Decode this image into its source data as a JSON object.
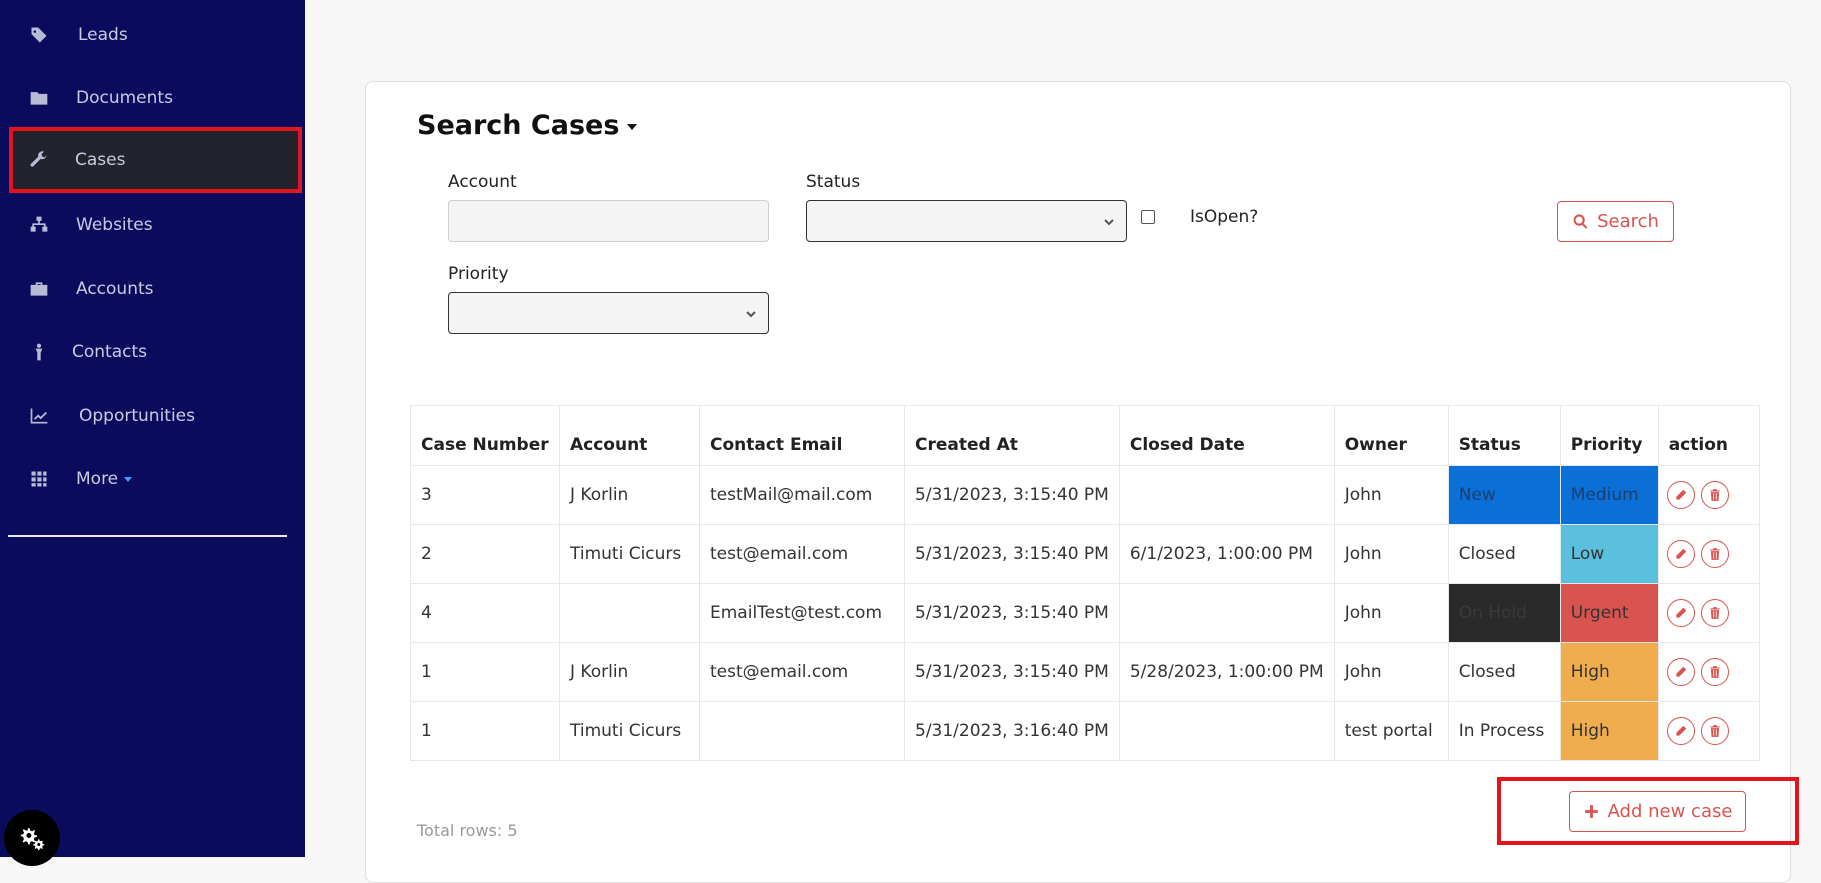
{
  "sidebar": {
    "items": [
      {
        "label": "Leads",
        "icon": "tags-icon"
      },
      {
        "label": "Documents",
        "icon": "folder-icon"
      },
      {
        "label": "Cases",
        "icon": "wrench-icon"
      },
      {
        "label": "Websites",
        "icon": "sitemap-icon"
      },
      {
        "label": "Accounts",
        "icon": "briefcase-icon"
      },
      {
        "label": "Contacts",
        "icon": "person-icon"
      },
      {
        "label": "Opportunities",
        "icon": "line-chart-icon"
      },
      {
        "label": "More",
        "icon": "grid-icon"
      }
    ],
    "active": "Cases"
  },
  "search": {
    "title": "Search Cases",
    "account_label": "Account",
    "account_value": "",
    "status_label": "Status",
    "status_value": "",
    "isopen_label": "IsOpen?",
    "isopen_checked": false,
    "priority_label": "Priority",
    "priority_value": "",
    "search_button": "Search"
  },
  "table": {
    "headers": [
      "Case Number",
      "Account",
      "Contact Email",
      "Created At",
      "Closed Date",
      "Owner",
      "Status",
      "Priority",
      "action"
    ],
    "rows": [
      {
        "case_number": "3",
        "account": "J Korlin",
        "email": "testMail@mail.com",
        "created": "5/31/2023, 3:15:40 PM",
        "closed": "",
        "owner": "John",
        "status": "New",
        "priority": "Medium"
      },
      {
        "case_number": "2",
        "account": "Timuti Cicurs",
        "email": "test@email.com",
        "created": "5/31/2023, 3:15:40 PM",
        "closed": "6/1/2023, 1:00:00 PM",
        "owner": "John",
        "status": "Closed",
        "priority": "Low"
      },
      {
        "case_number": "4",
        "account": "",
        "email": "EmailTest@test.com",
        "created": "5/31/2023, 3:15:40 PM",
        "closed": "",
        "owner": "John",
        "status": "On Hold",
        "priority": "Urgent"
      },
      {
        "case_number": "1",
        "account": "J Korlin",
        "email": "test@email.com",
        "created": "5/31/2023, 3:15:40 PM",
        "closed": "5/28/2023, 1:00:00 PM",
        "owner": "John",
        "status": "Closed",
        "priority": "High"
      },
      {
        "case_number": "1",
        "account": "Timuti Cicurs",
        "email": "",
        "created": "5/31/2023, 3:16:40 PM",
        "closed": "",
        "owner": "test portal",
        "status": "In Process",
        "priority": "High"
      }
    ]
  },
  "colors": {
    "status_new": "#0a6fd6",
    "status_on_hold": "#2a2a2a",
    "priority_medium": "#0a6fd6",
    "priority_low": "#5bc0de",
    "priority_urgent": "#d9534f",
    "priority_high": "#f0ad4e",
    "sidebar_bg": "#0b0b5e",
    "accent_red": "#d9534f"
  },
  "footer": {
    "total_rows": "Total rows: 5",
    "add_button": "Add new case"
  }
}
